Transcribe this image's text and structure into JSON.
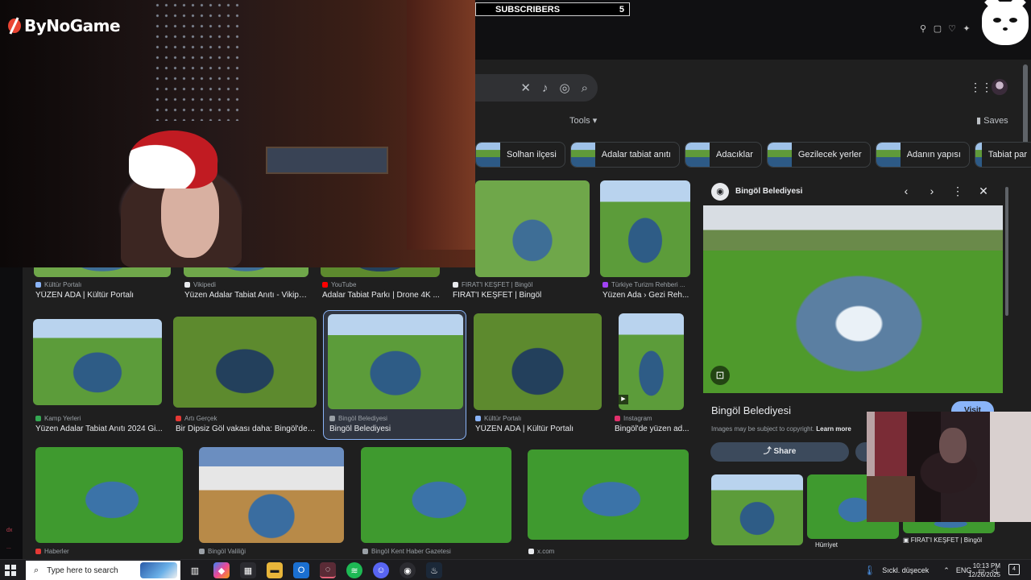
{
  "overlay": {
    "subscribers_label": "SUBSCRIBERS",
    "subscribers_count": "5",
    "brand": "ByNoGame"
  },
  "search": {
    "tools_label": "Tools",
    "saves_label": "Saves"
  },
  "chips": [
    {
      "label": "Solhan ilçesi"
    },
    {
      "label": "Adalar tabiat anıtı"
    },
    {
      "label": "Adacıklar"
    },
    {
      "label": "Gezilecek yerler"
    },
    {
      "label": "Adanın yapısı"
    },
    {
      "label": "Tabiat par"
    }
  ],
  "results": {
    "row1": [
      {
        "source": "Kültür Portalı",
        "title": "YÜZEN ADA | Kültür Portalı",
        "color": "#8ab4f8"
      },
      {
        "source": "Vikipedi",
        "title": "Yüzen Adalar Tabiat Anıtı - Vikipedi",
        "color": "#e8eaed"
      },
      {
        "source": "YouTube",
        "title": "Adalar Tabiat Parkı | Drone 4K ...",
        "color": "#ff0000"
      },
      {
        "source": "FIRAT'I KEŞFET | Bingöl",
        "title": "FIRAT'I KEŞFET | Bingöl",
        "color": "#e8eaed"
      },
      {
        "source": "Türkiye Turizm Rehberi ...",
        "title": "Yüzen Ada › Gezi Reh...",
        "color": "#a142f4"
      }
    ],
    "row2": [
      {
        "source": "Kamp Yerleri",
        "title": "Yüzen Adalar Tabiat Anıtı 2024 Gi...",
        "color": "#34a853"
      },
      {
        "source": "Artı Gerçek",
        "title": "Bir Dipsiz Göl vakası daha: Bingöl'dek...",
        "color": "#e53935"
      },
      {
        "source": "Bingöl Belediyesi",
        "title": "Bingöl Belediyesi",
        "color": "#9aa0a6"
      },
      {
        "source": "Kültür Portalı",
        "title": "YÜZEN ADA | Kültür Portalı",
        "color": "#8ab4f8"
      },
      {
        "source": "Instagram",
        "title": "Bingöl'de yüzen ad...",
        "color": "#e1306c"
      }
    ],
    "row3": [
      {
        "source": "Haberler",
        "color": "#e53935"
      },
      {
        "source": "Bingöl Valiliği",
        "color": "#9aa0a6"
      },
      {
        "source": "Bingöl Kent Haber Gazetesi",
        "color": "#9aa0a6"
      },
      {
        "source": "x.com",
        "color": "#e8eaed"
      }
    ]
  },
  "panel": {
    "header_title": "Bingöl Belediyesi",
    "title": "Bingöl Belediyesi",
    "visit_label": "Visit",
    "copyright_text": "Images may be subject to copyright.",
    "learn_more": "Learn more",
    "share_label": "Share",
    "related_caption_1": "Hürriyet",
    "related_caption_2": "FIRAT'I KEŞFET | Bingöl"
  },
  "taskbar": {
    "search_placeholder": "Type here to search",
    "weather": "Sıckl. düşecek",
    "language": "ENG",
    "time": "10:13 PM",
    "date": "12/26/2025",
    "notifications": "4"
  }
}
